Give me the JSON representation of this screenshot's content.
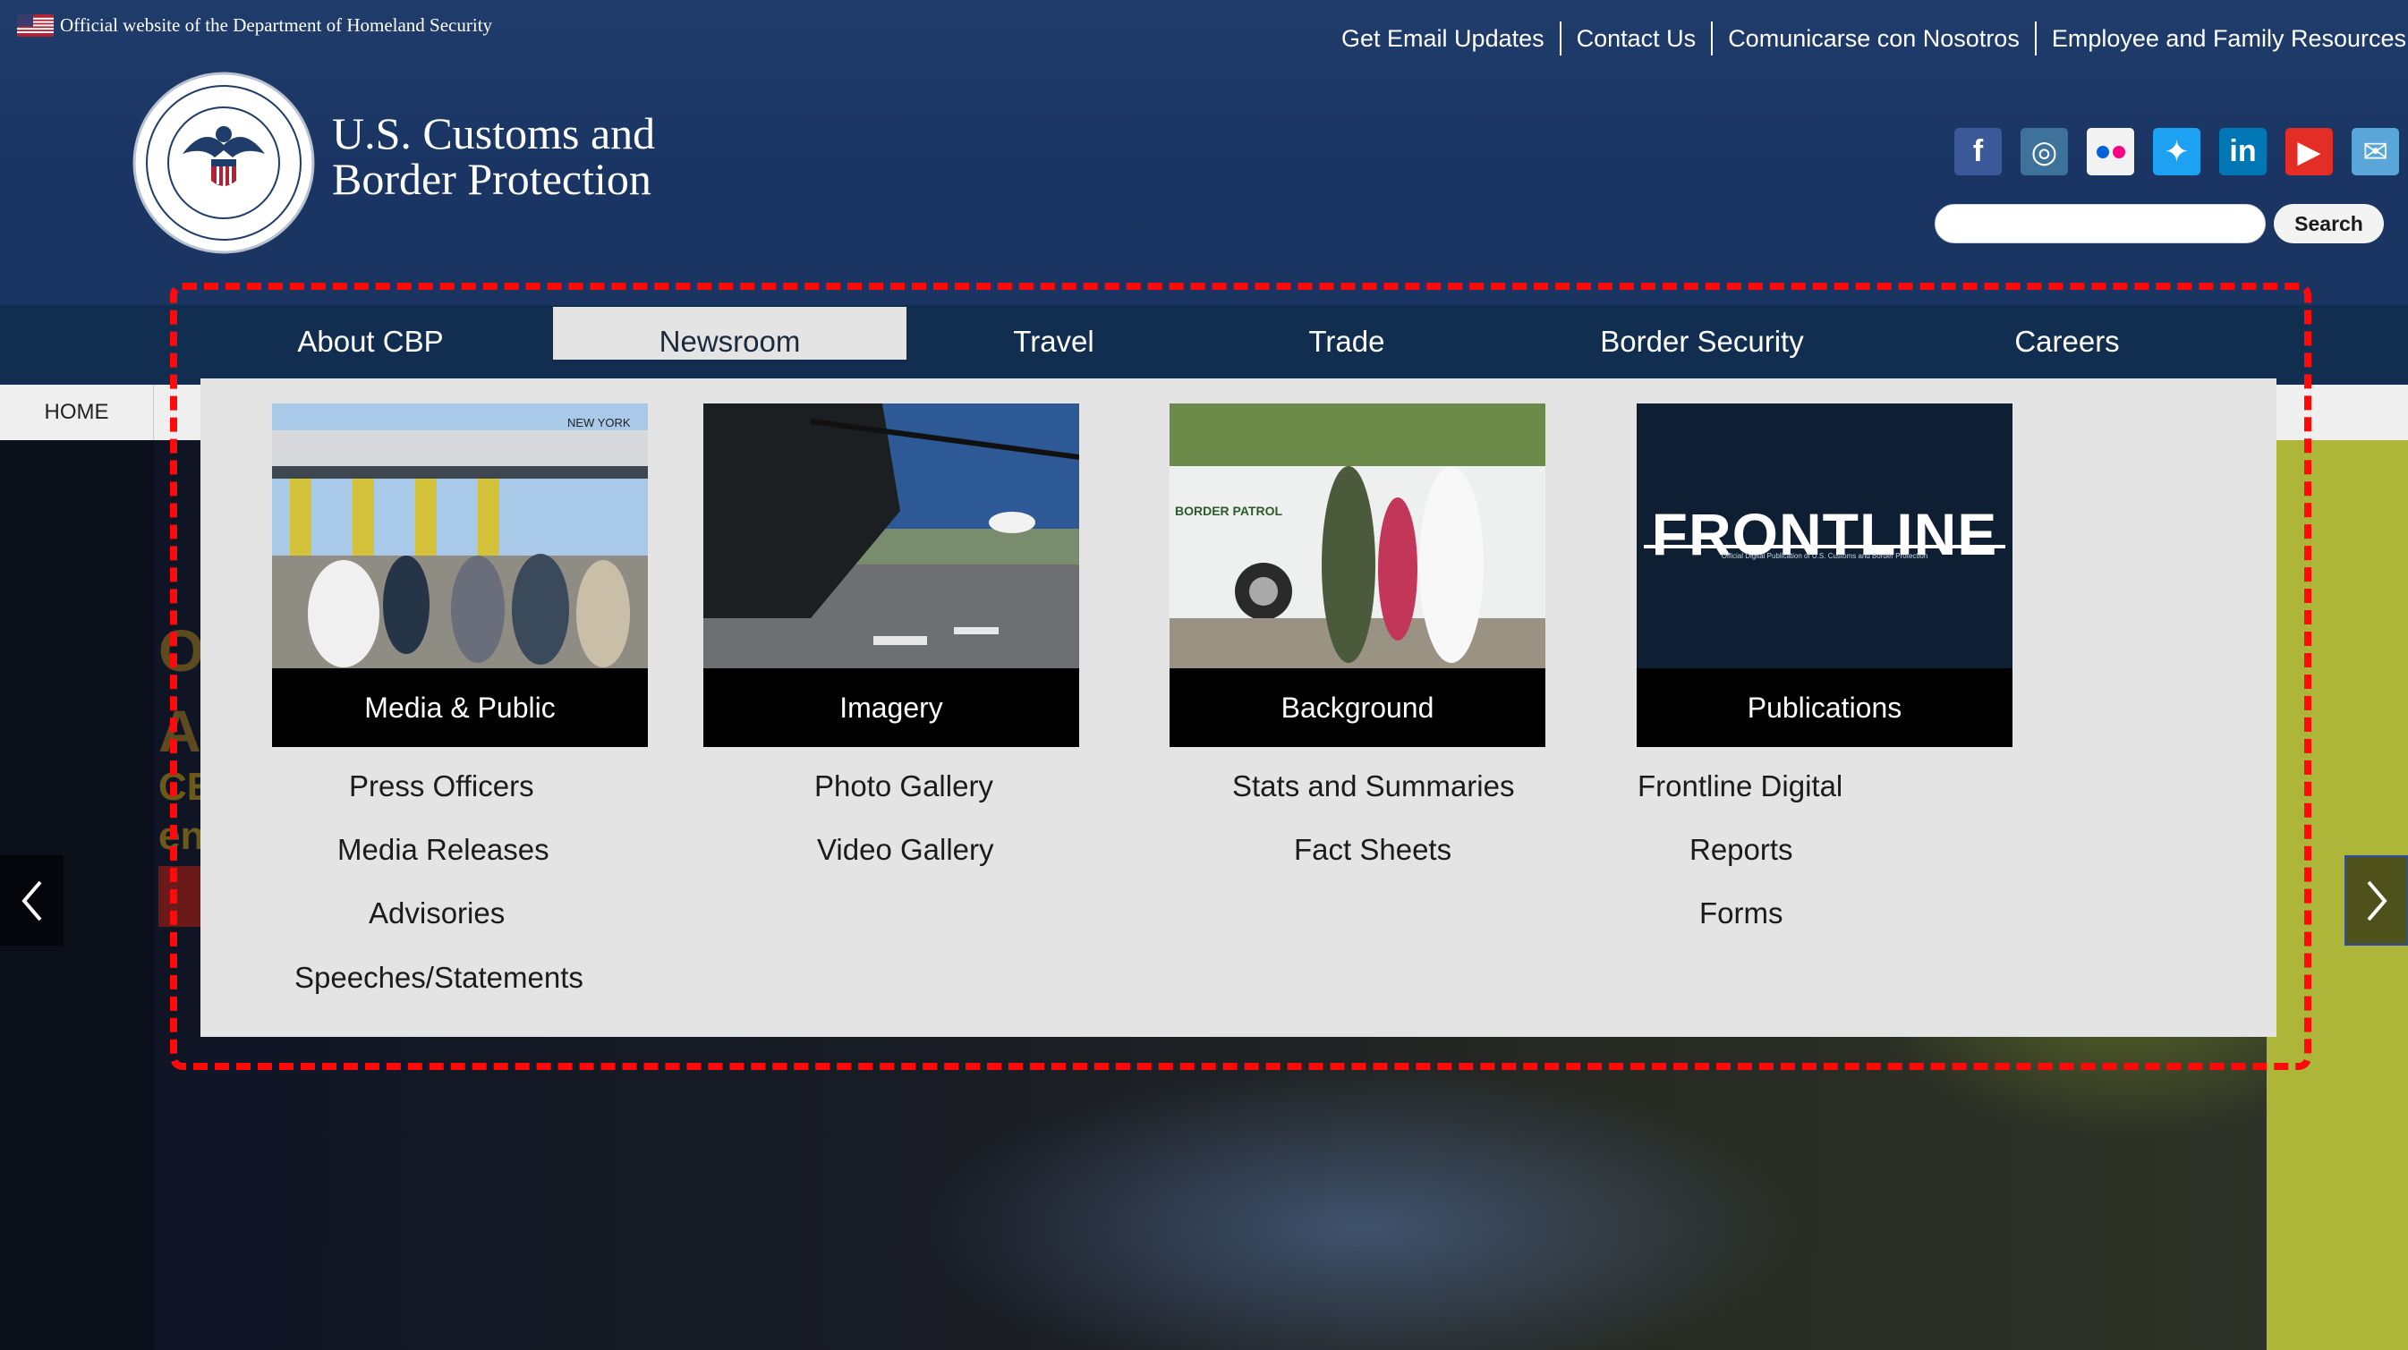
{
  "official_banner": "Official website of the Department of Homeland Security",
  "top_links": [
    "Get Email Updates",
    "Contact Us",
    "Comunicarse con Nosotros",
    "Employee and Family Resources"
  ],
  "site_name": {
    "line1": "U.S. Customs and",
    "line2": "Border Protection"
  },
  "seal_text": "U.S. CUSTOMS AND BORDER PROTECTION · DEPARTMENT OF HOMELAND SECURITY",
  "social_icons": [
    {
      "name": "facebook-icon",
      "glyph": "f",
      "color": "#3b5998"
    },
    {
      "name": "instagram-icon",
      "glyph": "◎",
      "color": "#3f729b"
    },
    {
      "name": "flickr-icon",
      "glyph": "••",
      "color": "#f2f2f2"
    },
    {
      "name": "twitter-icon",
      "glyph": "✦",
      "color": "#1da1f2"
    },
    {
      "name": "linkedin-icon",
      "glyph": "in",
      "color": "#0077b5"
    },
    {
      "name": "youtube-icon",
      "glyph": "▶",
      "color": "#e52d27"
    },
    {
      "name": "email-icon",
      "glyph": "✉",
      "color": "#5aa6d8"
    }
  ],
  "search": {
    "placeholder": "",
    "button": "Search"
  },
  "nav": [
    "About CBP",
    "Newsroom",
    "Travel",
    "Trade",
    "Border Security",
    "Careers"
  ],
  "nav_active": "Newsroom",
  "breadcrumb": {
    "home": "HOME"
  },
  "mega_menu": {
    "cards": [
      {
        "caption": "Media & Public",
        "links": [
          "Press Officers",
          "Media Releases",
          "Advisories",
          "Speeches/Statements"
        ]
      },
      {
        "caption": "Imagery",
        "links": [
          "Photo Gallery",
          "Video Gallery"
        ]
      },
      {
        "caption": "Background",
        "links": [
          "Stats and Summaries",
          "Fact Sheets"
        ]
      },
      {
        "caption": "Publications",
        "links": [
          "Frontline Digital",
          "Reports",
          "Forms"
        ]
      }
    ],
    "frontline_logo": "FRONTLINE",
    "frontline_tagline": "Official Digital Publication of U.S. Customs and Border Protection",
    "photo_signs": {
      "toll_sign": "NEW YORK",
      "vehicle_text": "BORDER PATROL"
    }
  },
  "hero": {
    "title_fragment": "O\nA",
    "subtitle_fragment": "CE\nen"
  },
  "colors": {
    "header": "#1b3562",
    "nav": "#112e51",
    "highlight": "#ff0a0a",
    "menu_bg": "#e4e4e4"
  }
}
